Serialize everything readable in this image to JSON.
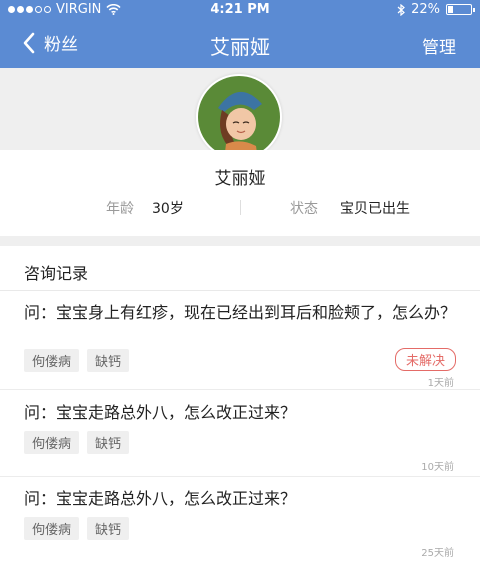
{
  "status_bar": {
    "carrier": "VIRGIN",
    "time": "4:21 PM",
    "battery_text": "22%",
    "battery_level": 0.22
  },
  "nav": {
    "back_label": "粉丝",
    "title": "艾丽娅",
    "action_label": "管理"
  },
  "profile": {
    "name": "艾丽娅",
    "age_label": "年龄",
    "age_value": "30岁",
    "status_label": "状态",
    "status_value": "宝贝已出生"
  },
  "records": {
    "title": "咨询记录",
    "items": [
      {
        "question": "问：宝宝身上有红疹，现在已经出到耳后和脸颊了，怎么办？",
        "tags": [
          "佝偻病",
          "缺钙"
        ],
        "status": "未解决",
        "time": "1天前"
      },
      {
        "question": "问：宝宝走路总外八，怎么改正过来？",
        "tags": [
          "佝偻病",
          "缺钙"
        ],
        "time": "10天前"
      },
      {
        "question": "问：宝宝走路总外八，怎么改正过来？",
        "tags": [
          "佝偻病",
          "缺钙"
        ],
        "time": "25天前"
      }
    ]
  },
  "colors": {
    "brand_blue": "#5b8bd3",
    "unresolved_red": "#e46b67"
  }
}
